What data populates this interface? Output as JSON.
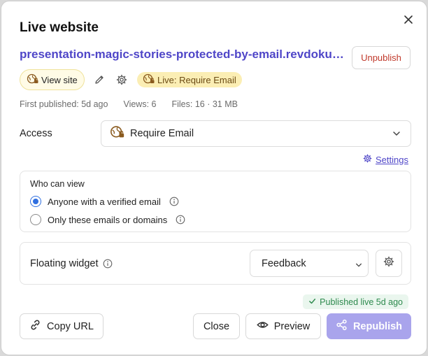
{
  "dialog": {
    "title": "Live website",
    "url_title": "presentation-magic-stories-protected-by-email.revdoku.com",
    "unpublish_label": "Unpublish",
    "view_site_label": "View site",
    "live_badge": "Live: Require Email",
    "stats": {
      "first_published": "First published: 5d ago",
      "views": "Views: 6",
      "files": "Files: 16 · 31 MB"
    },
    "access": {
      "label": "Access",
      "selected": "Require Email",
      "settings_link": "Settings"
    },
    "who_can_view": {
      "label": "Who can view",
      "options": [
        {
          "label": "Anyone with a verified email",
          "selected": true
        },
        {
          "label": "Only these emails or domains",
          "selected": false
        }
      ]
    },
    "floating_widget": {
      "label": "Floating widget",
      "selected": "Feedback"
    },
    "published_status": "Published live 5d ago",
    "buttons": {
      "copy_url": "Copy URL",
      "close": "Close",
      "preview": "Preview",
      "republish": "Republish"
    }
  },
  "colors": {
    "link": "#4f46c8",
    "danger": "#c0392b",
    "live_badge_bg": "#fbeeb4",
    "success": "#2e8a4e",
    "primary_disabled": "#a9a4ec",
    "radio_active": "#2f6fe0"
  },
  "icons": {
    "globe_lock": "globe-lock-icon",
    "pencil": "pencil-icon",
    "gear": "gear-icon",
    "chevron": "chevron-down-icon",
    "info": "info-icon",
    "link": "link-icon",
    "eye": "eye-icon",
    "share": "share-icon",
    "check": "check-icon",
    "close": "close-icon"
  }
}
